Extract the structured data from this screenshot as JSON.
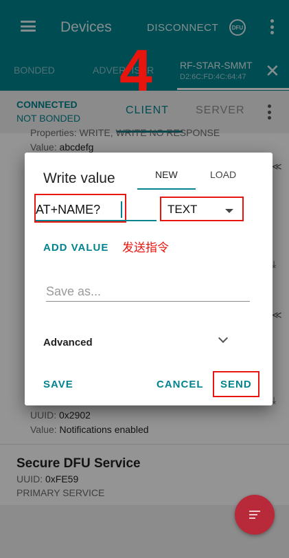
{
  "appbar": {
    "title": "Devices",
    "disconnect_label": "DISCONNECT",
    "dfu_icon_text": "DFU"
  },
  "device_tabs": {
    "bonded": "BONDED",
    "advertiser": "ADVERTISER",
    "device_name": "RF-STAR-SMMT",
    "device_address": "D2:6C:FD:4C:64:47",
    "close_symbol": "✕"
  },
  "annotations": {
    "step_number": "4",
    "send_command": "发送指令"
  },
  "connection": {
    "state": "CONNECTED",
    "bond_state": "NOT BONDED",
    "tab_client": "CLIENT",
    "tab_server": "SERVER"
  },
  "background_list": {
    "properties_line": "Properties: WRITE, WRITE NO RESPONSE",
    "value_label": "Value: ",
    "value_text": "abcdefg",
    "descriptor_uuid_label": "UUID: ",
    "descriptor_uuid": "0x2902",
    "descriptor_value_label": "Value: ",
    "descriptor_value": "Notifications enabled",
    "service_name": "Secure DFU Service",
    "service_uuid_label": "UUID: ",
    "service_uuid": "0xFE59",
    "service_type": "PRIMARY SERVICE"
  },
  "dialog": {
    "title": "Write value",
    "tab_new": "NEW",
    "tab_load": "LOAD",
    "value": "AT+NAME?",
    "type_selected": "TEXT",
    "add_value_label": "ADD VALUE",
    "save_as_placeholder": "Save as...",
    "advanced_label": "Advanced",
    "save_label": "SAVE",
    "cancel_label": "CANCEL",
    "send_label": "SEND"
  },
  "colors": {
    "primary": "#00838f",
    "accent": "#b8293a",
    "annotation_red": "#e8140e"
  }
}
